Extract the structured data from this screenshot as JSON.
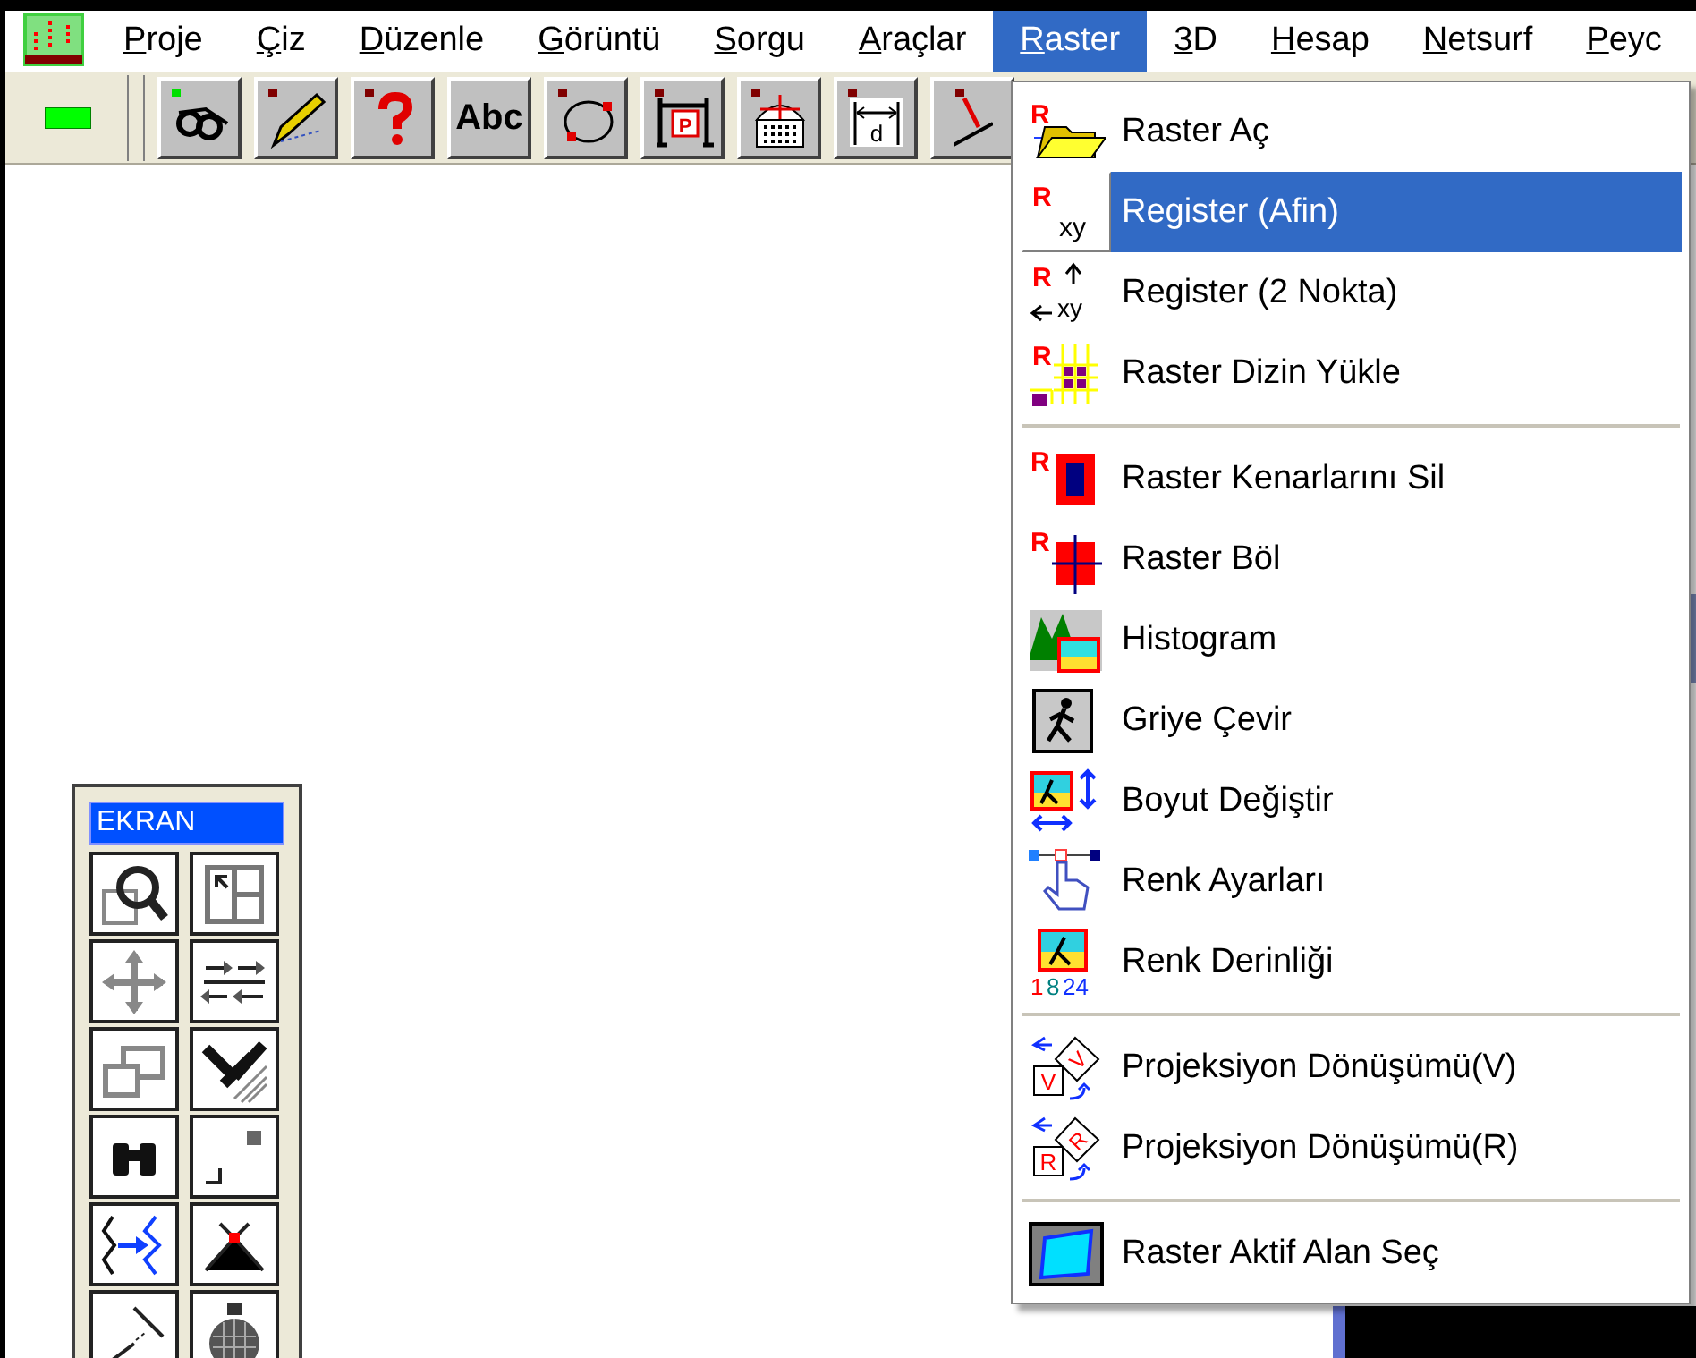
{
  "menu_bar": {
    "items": [
      {
        "label": "Proje",
        "mnemonic": true,
        "selected": false
      },
      {
        "label": "Çiz",
        "mnemonic": true,
        "selected": false
      },
      {
        "label": "Düzenle",
        "mnemonic": true,
        "selected": false
      },
      {
        "label": "Görüntü",
        "mnemonic": true,
        "selected": false
      },
      {
        "label": "Sorgu",
        "mnemonic": true,
        "selected": false
      },
      {
        "label": "Araçlar",
        "mnemonic": true,
        "selected": false
      },
      {
        "label": "Raster",
        "mnemonic": true,
        "selected": true
      },
      {
        "label": "3D",
        "mnemonic": true,
        "selected": false
      },
      {
        "label": "Hesap",
        "mnemonic": true,
        "selected": false
      },
      {
        "label": "Netsurf",
        "mnemonic": true,
        "selected": false
      },
      {
        "label": "Peyc",
        "mnemonic": true,
        "selected": false
      }
    ]
  },
  "toolbar": {
    "buttons": [
      {
        "kind": "green"
      },
      {
        "kind": "glasses"
      },
      {
        "kind": "pencil"
      },
      {
        "kind": "help"
      },
      {
        "kind": "text",
        "label": "Abc"
      },
      {
        "kind": "circle"
      },
      {
        "kind": "plot",
        "label": "P"
      },
      {
        "kind": "grid"
      },
      {
        "kind": "dimension",
        "label": "d"
      },
      {
        "kind": "line"
      }
    ]
  },
  "raster_menu": {
    "groups": [
      [
        {
          "label": "Raster Aç",
          "selected": false,
          "icon_text": [
            "R"
          ]
        },
        {
          "label": "Register (Afin)",
          "selected": true,
          "icon_text": [
            "R",
            "xy"
          ]
        },
        {
          "label": "Register (2 Nokta)",
          "selected": false,
          "icon_text": [
            "R",
            "xy"
          ]
        },
        {
          "label": "Raster Dizin Yükle",
          "selected": false,
          "icon_text": [
            "R"
          ]
        }
      ],
      [
        {
          "label": "Raster Kenarlarını Sil",
          "selected": false,
          "icon_text": [
            "R"
          ]
        },
        {
          "label": "Raster Böl",
          "selected": false,
          "icon_text": [
            "R"
          ]
        },
        {
          "label": "Histogram",
          "selected": false
        },
        {
          "label": "Griye Çevir",
          "selected": false
        },
        {
          "label": "Boyut Değiştir",
          "selected": false
        },
        {
          "label": "Renk Ayarları",
          "selected": false
        },
        {
          "label": "Renk Derinliği",
          "selected": false,
          "icon_text": [
            "1",
            "8",
            "24"
          ]
        }
      ],
      [
        {
          "label": "Projeksiyon Dönüşümü(V)",
          "selected": false,
          "icon_text": [
            "V",
            "V"
          ]
        },
        {
          "label": "Projeksiyon Dönüşümü(R)",
          "selected": false,
          "icon_text": [
            "R",
            "R"
          ]
        }
      ],
      [
        {
          "label": "Raster Aktif Alan Seç",
          "selected": false
        }
      ]
    ]
  },
  "palette": {
    "title": "EKRAN",
    "buttons": [
      {
        "kind": "zoom"
      },
      {
        "kind": "window"
      },
      {
        "kind": "pan"
      },
      {
        "kind": "swap"
      },
      {
        "kind": "copy"
      },
      {
        "kind": "brush"
      },
      {
        "kind": "binoculars"
      },
      {
        "kind": "corner"
      },
      {
        "kind": "arrows"
      },
      {
        "kind": "cross"
      },
      {
        "kind": "diagonal"
      },
      {
        "kind": "grenade"
      }
    ]
  }
}
